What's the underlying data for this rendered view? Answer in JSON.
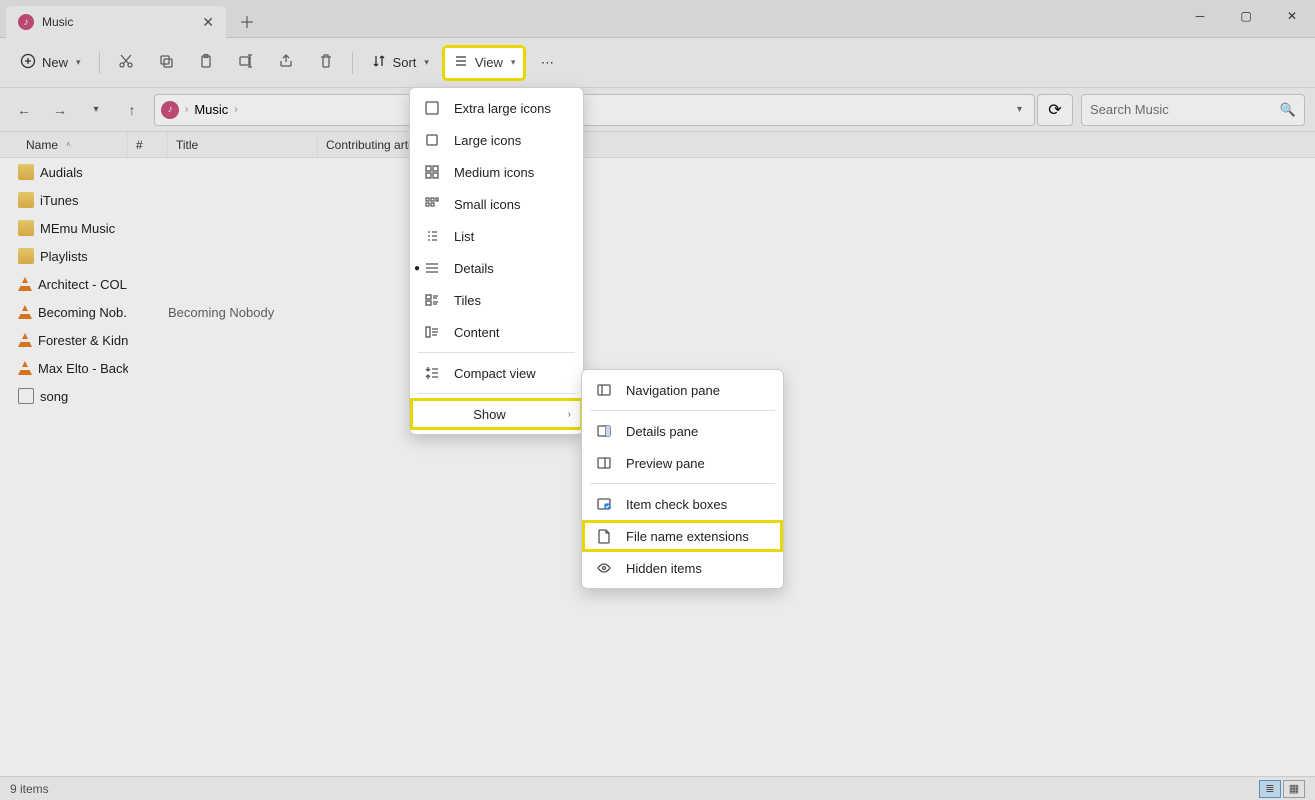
{
  "window": {
    "tab_title": "Music",
    "new_button": "New",
    "sort_button": "Sort",
    "view_button": "View"
  },
  "breadcrumb": {
    "item": "Music"
  },
  "search": {
    "placeholder": "Search Music"
  },
  "columns": {
    "name": "Name",
    "num": "#",
    "title": "Title",
    "contrib": "Contributing artists"
  },
  "rows": [
    {
      "type": "folder",
      "name": "Audials",
      "title": ""
    },
    {
      "type": "folder",
      "name": "iTunes",
      "title": ""
    },
    {
      "type": "folder",
      "name": "MEmu Music",
      "title": ""
    },
    {
      "type": "folder",
      "name": "Playlists",
      "title": ""
    },
    {
      "type": "vlc",
      "name": "Architect - COL...",
      "title": ""
    },
    {
      "type": "vlc",
      "name": "Becoming Nob...",
      "title": "Becoming Nobody"
    },
    {
      "type": "vlc",
      "name": "Forester & Kidn...",
      "title": ""
    },
    {
      "type": "vlc",
      "name": "Max Elto - Back...",
      "title": ""
    },
    {
      "type": "media",
      "name": "song",
      "title": ""
    }
  ],
  "view_menu": {
    "extra_large": "Extra large icons",
    "large": "Large icons",
    "medium": "Medium icons",
    "small": "Small icons",
    "list": "List",
    "details": "Details",
    "tiles": "Tiles",
    "content": "Content",
    "compact": "Compact view",
    "show": "Show"
  },
  "show_menu": {
    "nav_pane": "Navigation pane",
    "details_pane": "Details pane",
    "preview_pane": "Preview pane",
    "item_checks": "Item check boxes",
    "file_ext": "File name extensions",
    "hidden": "Hidden items"
  },
  "status": {
    "count": "9 items"
  }
}
